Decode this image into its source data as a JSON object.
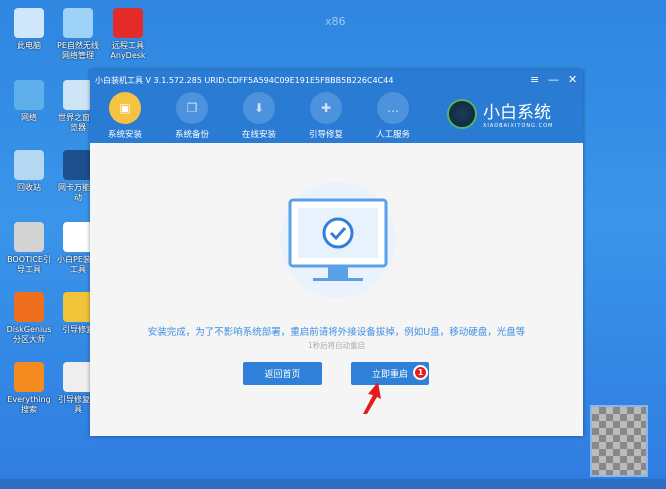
{
  "watermark": "x86",
  "desktop": [
    {
      "label": "此电脑",
      "color": "#cfe6fb"
    },
    {
      "label": "PE自然无线网络管理",
      "color": "#9fd2f7"
    },
    {
      "label": "远程工具AnyDesk",
      "color": "#e32b2b"
    },
    {
      "label": "网络",
      "color": "#5fb0ea"
    },
    {
      "label": "世界之窗浏览器",
      "color": "#cfe3f7"
    },
    {
      "label": "回收站",
      "color": "#b5d8f2"
    },
    {
      "label": "网卡万能驱动",
      "color": "#1d4f8c"
    },
    {
      "label": "BOOTICE引导工具",
      "color": "#d3d3d3"
    },
    {
      "label": "小白PE装机工具",
      "color": "#ffffff"
    },
    {
      "label": "DiskGenius分区大师",
      "color": "#f06f1f"
    },
    {
      "label": "引导修复",
      "color": "#f0c53a"
    },
    {
      "label": "Everything搜索",
      "color": "#f58a1f"
    },
    {
      "label": "引导修复工具",
      "color": "#eeeeee"
    }
  ],
  "window": {
    "title": "小白装机工具 V 3.1.572.285 URID:CDFF5A594C09E191E5FBBB5B226C4C44",
    "controls": [
      "≡",
      "—",
      "✕"
    ],
    "nav": [
      {
        "label": "系统安装",
        "icon": "box-icon"
      },
      {
        "label": "系统备份",
        "icon": "backup-icon"
      },
      {
        "label": "在线安装",
        "icon": "download-icon"
      },
      {
        "label": "引导修复",
        "icon": "toolbox-icon"
      },
      {
        "label": "人工服务",
        "icon": "chat-icon"
      }
    ],
    "logo_name": "小白系统",
    "logo_sub": "XIAOBAIXITONG.COM",
    "message": "安装完成，为了不影响系统部署，重启前请将外接设备拔掉，例如U盘，移动硬盘，光盘等",
    "countdown": "1秒后将自动重启",
    "back_button": "返回首页",
    "restart_button": "立即重启",
    "badge": "1"
  },
  "accent": "#2a7bd3"
}
